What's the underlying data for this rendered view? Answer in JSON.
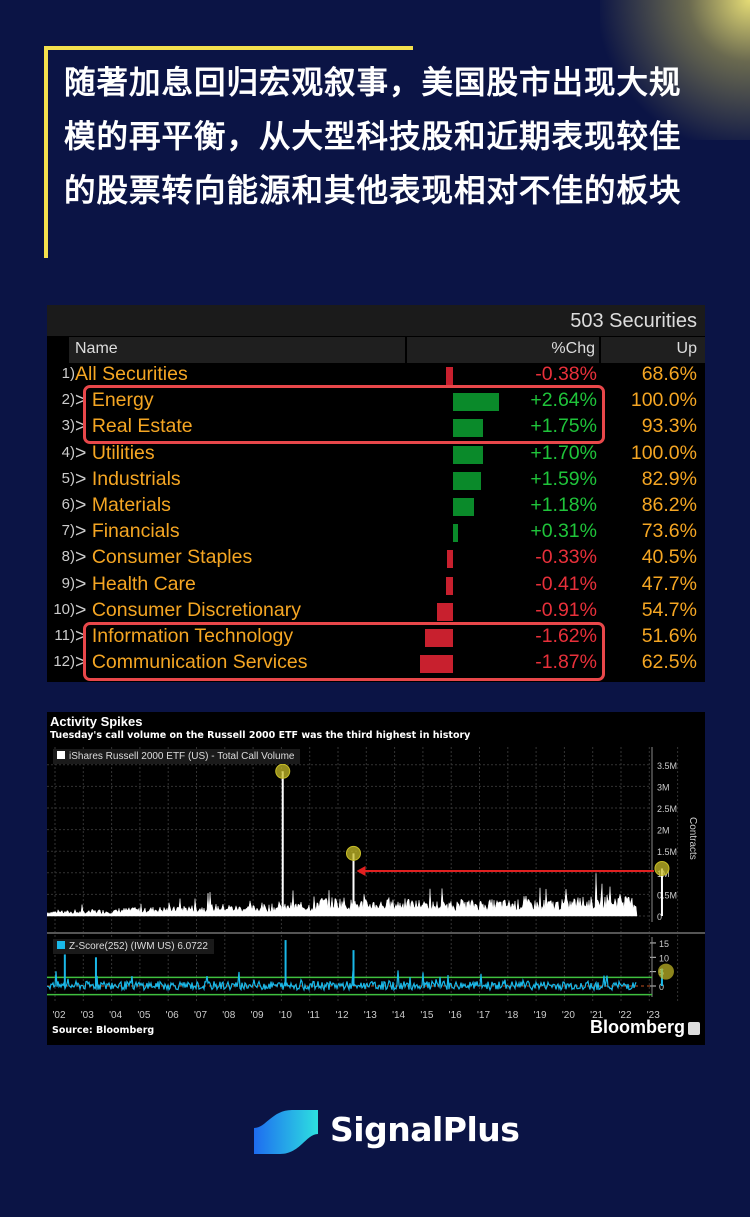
{
  "headline": "随著加息回归宏观叙事，美国股市出现大规模的再平衡，从大型科技股和近期表现较佳的股票转向能源和其他表现相对不佳的板块",
  "table": {
    "count_label": "503 Securities",
    "columns": [
      "Name",
      "%Chg",
      "Up"
    ],
    "rows": [
      {
        "num": "1)",
        "name": "All Securities",
        "chg": "-0.38%",
        "chg_value": -0.38,
        "up": "68.6%"
      },
      {
        "num": "2)",
        "name": "Energy",
        "chg": "+2.64%",
        "chg_value": 2.64,
        "up": "100.0%",
        "expand": ">"
      },
      {
        "num": "3)",
        "name": "Real Estate",
        "chg": "+1.75%",
        "chg_value": 1.75,
        "up": "93.3%",
        "expand": ">"
      },
      {
        "num": "4)",
        "name": "Utilities",
        "chg": "+1.70%",
        "chg_value": 1.7,
        "up": "100.0%",
        "expand": ">"
      },
      {
        "num": "5)",
        "name": "Industrials",
        "chg": "+1.59%",
        "chg_value": 1.59,
        "up": "82.9%",
        "expand": ">"
      },
      {
        "num": "6)",
        "name": "Materials",
        "chg": "+1.18%",
        "chg_value": 1.18,
        "up": "86.2%",
        "expand": ">"
      },
      {
        "num": "7)",
        "name": "Financials",
        "chg": "+0.31%",
        "chg_value": 0.31,
        "up": "73.6%",
        "expand": ">"
      },
      {
        "num": "8)",
        "name": "Consumer Staples",
        "chg": "-0.33%",
        "chg_value": -0.33,
        "up": "40.5%",
        "expand": ">"
      },
      {
        "num": "9)",
        "name": "Health Care",
        "chg": "-0.41%",
        "chg_value": -0.41,
        "up": "47.7%",
        "expand": ">"
      },
      {
        "num": "10)",
        "name": "Consumer Discretionary",
        "chg": "-0.91%",
        "chg_value": -0.91,
        "up": "54.7%",
        "expand": ">"
      },
      {
        "num": "11)",
        "name": "Information Technology",
        "chg": "-1.62%",
        "chg_value": -1.62,
        "up": "51.6%",
        "expand": ">"
      },
      {
        "num": "12)",
        "name": "Communication Services",
        "chg": "-1.87%",
        "chg_value": -1.87,
        "up": "62.5%",
        "expand": ">"
      }
    ],
    "colors": {
      "positive": "#1fc43a",
      "negative": "#e8303a",
      "highlight": "#e8474a",
      "name": "#f5a623"
    }
  },
  "chart_data": {
    "type": "line",
    "title": "Activity Spikes",
    "subtitle": "Tuesday's call volume on the Russell 2000 ETF was the third highest in history",
    "source": "Source: Bloomberg",
    "brand": "Bloomberg",
    "x_ticks": [
      "'02",
      "'03",
      "'04",
      "'05",
      "'06",
      "'07",
      "'08",
      "'09",
      "'10",
      "'11",
      "'12",
      "'13",
      "'14",
      "'15",
      "'16",
      "'17",
      "'18",
      "'19",
      "'20",
      "'21",
      "'22",
      "'23"
    ],
    "panels": [
      {
        "legend": "iShares Russell 2000 ETF (US) - Total Call Volume",
        "ylabel": "Contracts",
        "y_ticks": [
          "0",
          "0.5M",
          "1M",
          "1.5M",
          "2M",
          "2.5M",
          "3M",
          "3.5M"
        ],
        "ylim": [
          0,
          3.5
        ],
        "unit": "M",
        "series_yearly_typical": [
          0.1,
          0.12,
          0.15,
          0.17,
          0.2,
          0.22,
          0.2,
          0.22,
          0.25,
          0.35,
          0.3,
          0.3,
          0.3,
          0.28,
          0.3,
          0.3,
          0.3,
          0.3,
          0.35,
          0.4,
          0.35,
          0.6
        ],
        "highlighted_spikes": [
          {
            "year": 2009.8,
            "value": 3.35
          },
          {
            "year": 2012.3,
            "value": 1.45
          },
          {
            "year": 2023.2,
            "value": 1.1
          }
        ],
        "color": "#ffffff"
      },
      {
        "legend": "Z-Score(252) (IWM US) 6.0722",
        "y_ticks": [
          "0",
          "5",
          "10",
          "15"
        ],
        "ylim": [
          -3,
          17
        ],
        "spikes": [
          {
            "year": 2002.1,
            "value": 11
          },
          {
            "year": 2003.2,
            "value": 10
          },
          {
            "year": 2009.9,
            "value": 16
          },
          {
            "year": 2012.3,
            "value": 12.5
          },
          {
            "year": 2023.2,
            "value": 6.07
          }
        ],
        "reference_lines": [
          3,
          -3
        ],
        "color": "#1ab8e8"
      }
    ]
  },
  "logo": {
    "text": "SignalPlus"
  }
}
